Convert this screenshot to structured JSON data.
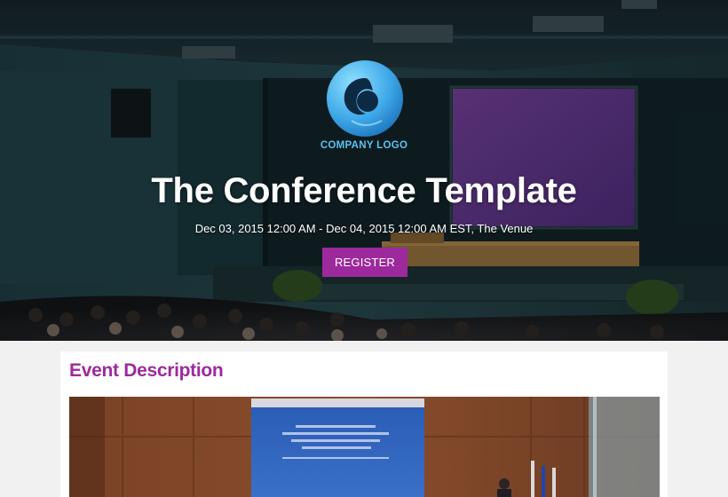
{
  "hero": {
    "logo_text": "COMPANY LOGO",
    "title": "The Conference Template",
    "subtitle": "Dec 03, 2015 12:00 AM - Dec 04, 2015 12:00 AM EST, The Venue",
    "register_label": "REGISTER",
    "logo_icon": "company-logo-icon"
  },
  "main": {
    "section_title": "Event Description"
  },
  "colors": {
    "accent": "#9c2a9c",
    "logo_blue": "#5cc2ee",
    "page_bg": "#f1f1f1"
  }
}
